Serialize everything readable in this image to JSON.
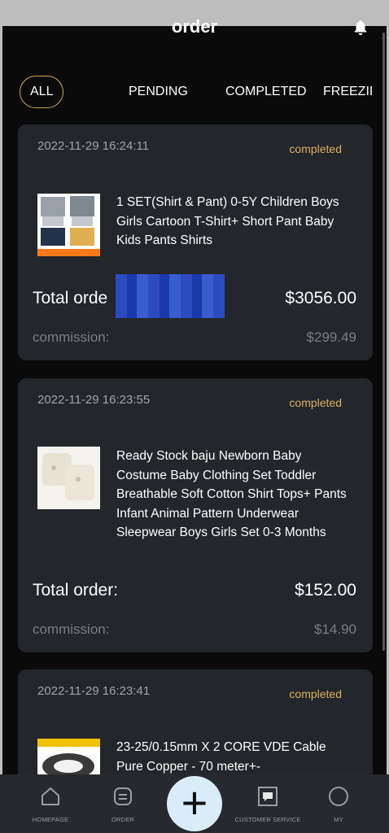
{
  "header": {
    "title": "order"
  },
  "tabs": [
    {
      "label": "ALL",
      "active": true
    },
    {
      "label": "PENDING",
      "active": false
    },
    {
      "label": "COMPLETED",
      "active": false
    },
    {
      "label": "FREEZII",
      "active": false
    }
  ],
  "orders": [
    {
      "timestamp": "2022-11-29 16:24:11",
      "status": "completed",
      "description": "1 SET(Shirt & Pant) 0-5Y Children Boys Girls Cartoon T-Shirt+ Short Pant Baby Kids Pants Shirts",
      "total_label": "Total orde",
      "total_value": "$3056.00",
      "commission_label": "commission:",
      "commission_value": "$299.49"
    },
    {
      "timestamp": "2022-11-29 16:23:55",
      "status": "completed",
      "description": "Ready Stock baju Newborn Baby Costume Baby Clothing Set Toddler Breathable Soft Cotton Shirt Tops+ Pants Infant Animal Pattern Underwear Sleepwear Boys Girls Set 0-3 Months",
      "total_label": "Total order:",
      "total_value": "$152.00",
      "commission_label": "commission:",
      "commission_value": "$14.90"
    },
    {
      "timestamp": "2022-11-29 16:23:41",
      "status": "completed",
      "description": "23-25/0.15mm X 2 CORE VDE Cable Pure Copper - 70 meter+-"
    }
  ],
  "bottom_nav": [
    {
      "label": "HOMEPAGE",
      "icon": "home-icon"
    },
    {
      "label": "ORDER",
      "icon": "order-icon"
    },
    {
      "label": "",
      "icon": "plus-icon"
    },
    {
      "label": "CUSTOMER SERVICE",
      "icon": "chat-icon"
    },
    {
      "label": "MY",
      "icon": "profile-icon"
    }
  ],
  "fab": {
    "symbol": "+"
  },
  "colors": {
    "accent": "#d8b160",
    "card": "#23262b",
    "background": "#0a0a0a"
  }
}
